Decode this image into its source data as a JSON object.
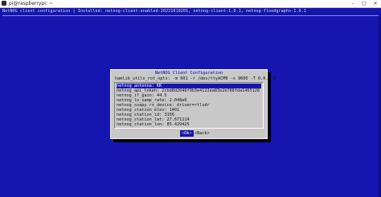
{
  "window": {
    "title": "pi@raspberrypi: ~",
    "minimize_glyph": "–",
    "maximize_glyph": "□",
    "close_glyph": "✕"
  },
  "terminal": {
    "backtitle": "NetNOG client configuration | Installed: netnog-client-enabled-20221010201, netnog-client-1.0.1, netnog-floodgraphs-1.0.1"
  },
  "dialog": {
    "title": "NetNOG Client Configuration",
    "command": "hamlib_utils_rot_opts: -m 601 -r /dev/ttyACM0 -s 9600 -T 0.0.0.0",
    "fields": [
      {
        "key": "netnog_antenna",
        "value": "KK"
      },
      {
        "key": "netnog_api_token",
        "value": "2cbd8d2046f9b3e4122ea83e2b788fda1465128"
      },
      {
        "key": "netnog_if_gain",
        "value": "44.5"
      },
      {
        "key": "netnog_lo_samp_rate",
        "value": "2.048e6"
      },
      {
        "key": "netnog_soapy_rx_device",
        "value": "driver=rtlsdr"
      },
      {
        "key": "netnog_station_elev",
        "value": "1401"
      },
      {
        "key": "netnog_station_id",
        "value": "3156"
      },
      {
        "key": "netnog_station_lat",
        "value": "27.671114"
      },
      {
        "key": "netnog_station_lon",
        "value": "85.429425"
      }
    ],
    "buttons": {
      "ok_hotkey": "<",
      "ok_label": "Ok",
      "ok_close": ">",
      "back_label": "<Back>"
    }
  },
  "colors": {
    "terminal_bg": "#1515b0",
    "dialog_bg": "#c8c8c8",
    "selection_bg": "#1515b0",
    "title_text": "#0000b8"
  }
}
